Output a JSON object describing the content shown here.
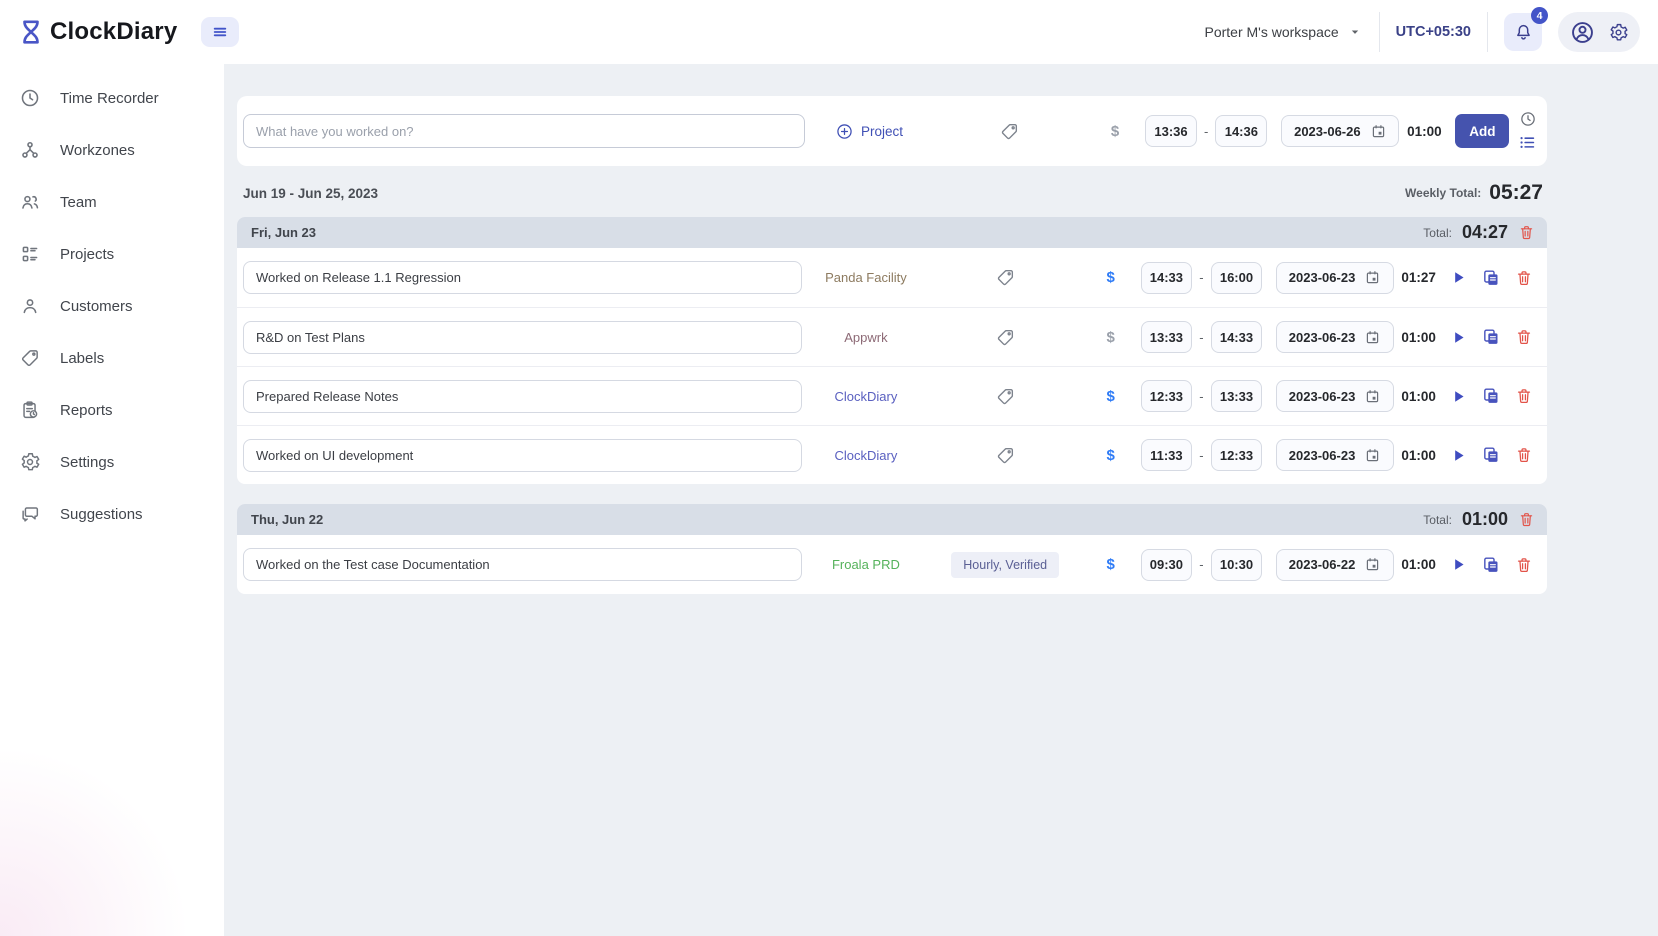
{
  "app": {
    "name": "ClockDiary"
  },
  "header": {
    "workspace": "Porter M's workspace",
    "timezone": "UTC+05:30",
    "notification_count": "4"
  },
  "sidebar": {
    "items": [
      {
        "label": "Time Recorder",
        "icon": "i-clock",
        "name": "time-recorder"
      },
      {
        "label": "Workzones",
        "icon": "i-workzones",
        "name": "workzones"
      },
      {
        "label": "Team",
        "icon": "i-team",
        "name": "team"
      },
      {
        "label": "Projects",
        "icon": "i-projects",
        "name": "projects"
      },
      {
        "label": "Customers",
        "icon": "i-person",
        "name": "customers"
      },
      {
        "label": "Labels",
        "icon": "i-tag",
        "name": "labels"
      },
      {
        "label": "Reports",
        "icon": "i-reports",
        "name": "reports"
      },
      {
        "label": "Settings",
        "icon": "i-gear",
        "name": "settings"
      },
      {
        "label": "Suggestions",
        "icon": "i-chat",
        "name": "suggestions"
      }
    ]
  },
  "symbols": {
    "billable": "$",
    "time_separator": "-"
  },
  "entry_bar": {
    "placeholder": "What have you worked on?",
    "project_label": "Project",
    "start": "13:36",
    "end": "14:36",
    "date": "2023-06-26",
    "duration": "01:00",
    "add_label": "Add"
  },
  "week": {
    "range": "Jun 19 - Jun 25, 2023",
    "total_label": "Weekly Total:",
    "total": "05:27"
  },
  "groups": [
    {
      "day": "Fri, Jun 23",
      "total_label": "Total:",
      "total": "04:27",
      "entries": [
        {
          "description": "Worked on Release 1.1 Regression",
          "project": "Panda Facility",
          "project_color": "#8d7b60",
          "labels": null,
          "billable": true,
          "start": "14:33",
          "end": "16:00",
          "date": "2023-06-23",
          "duration": "01:27"
        },
        {
          "description": "R&D on Test Plans",
          "project": "Appwrk",
          "project_color": "#8d6a76",
          "labels": null,
          "billable": false,
          "start": "13:33",
          "end": "14:33",
          "date": "2023-06-23",
          "duration": "01:00"
        },
        {
          "description": "Prepared Release Notes",
          "project": "ClockDiary",
          "project_color": "#5a60c0",
          "labels": null,
          "billable": true,
          "start": "12:33",
          "end": "13:33",
          "date": "2023-06-23",
          "duration": "01:00"
        },
        {
          "description": "Worked on UI development",
          "project": "ClockDiary",
          "project_color": "#5a60c0",
          "labels": null,
          "billable": true,
          "start": "11:33",
          "end": "12:33",
          "date": "2023-06-23",
          "duration": "01:00"
        }
      ]
    },
    {
      "day": "Thu, Jun 22",
      "total_label": "Total:",
      "total": "01:00",
      "entries": [
        {
          "description": "Worked on the Test case Documentation",
          "project": "Froala PRD",
          "project_color": "#55b25b",
          "labels": "Hourly, Verified",
          "billable": true,
          "start": "09:30",
          "end": "10:30",
          "date": "2023-06-22",
          "duration": "01:00"
        }
      ]
    }
  ],
  "colors": {
    "accent": "#4553ae",
    "billable_active": "#2e7bf6",
    "billable_inactive": "#9aa0aa",
    "danger": "#e25349",
    "day_header_bg": "#d8dee7",
    "main_bg": "#edf0f4"
  },
  "icons": {
    "logo": "hourglass-icon",
    "menu": "hamburger-icon",
    "workspace": "caret-down-icon",
    "notifications": "bell-icon",
    "account": "person-circle-icon",
    "settings": "gear-icon",
    "project": "plus-circle-icon",
    "label": "tag-icon",
    "date": "calendar-icon",
    "row_actions": [
      "play-icon",
      "copy-icon",
      "trash-icon"
    ],
    "modes": [
      "clock-icon",
      "list-icon"
    ]
  }
}
